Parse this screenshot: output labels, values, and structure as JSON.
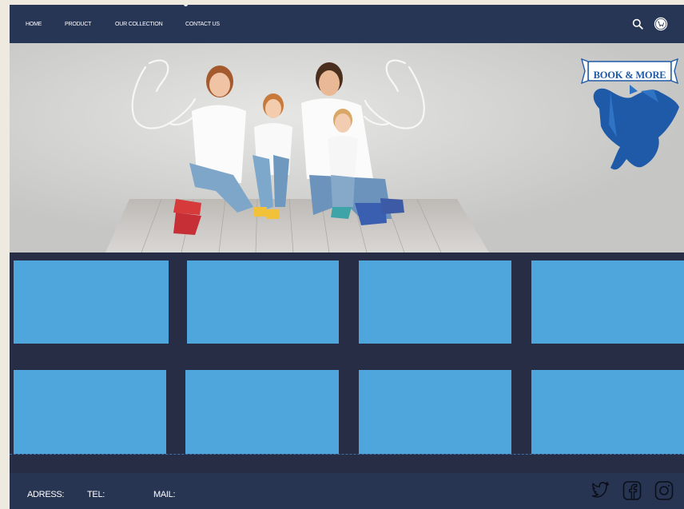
{
  "nav": {
    "items": [
      {
        "label": "HOME",
        "icon": ""
      },
      {
        "label": "PRODUCT",
        "icon": ""
      },
      {
        "label": "OUR COLLECTION",
        "icon": ""
      },
      {
        "label": "CONTACT US",
        "icon": ""
      }
    ],
    "search_icon": "search-icon",
    "cart_icon": "cart-icon"
  },
  "hero": {
    "logo_text": "BOOK & MORE",
    "logo_icon": "dove-book-icon",
    "image_description_icon": "family-photo"
  },
  "colors": {
    "nav_bg": "#283656",
    "page_bg": "#272d45",
    "tile": "#4fa6dd",
    "logo_blue": "#1e5aa8"
  },
  "footer": {
    "address_label": "ADRESS:",
    "tel_label": "TEL:",
    "mail_label": "MAIL:",
    "social": [
      "twitter-icon",
      "facebook-icon",
      "instagram-icon"
    ]
  }
}
